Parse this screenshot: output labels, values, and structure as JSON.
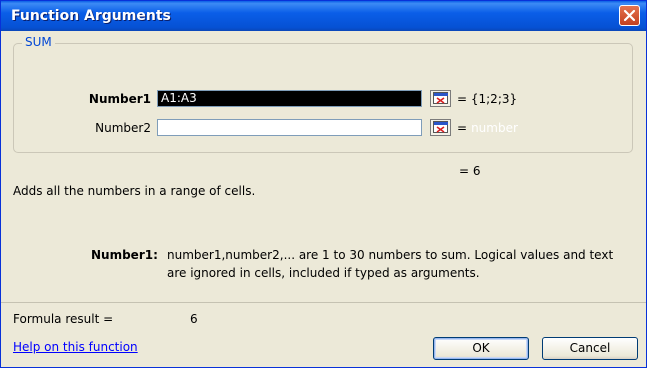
{
  "window": {
    "title": "Function Arguments"
  },
  "function_name": "SUM",
  "args": [
    {
      "label": "Number1",
      "value": "A1:A3",
      "result": "= {1;2;3}",
      "hint": ""
    },
    {
      "label": "Number2",
      "value": "",
      "result": "=",
      "hint": "number"
    }
  ],
  "function_result": "= 6",
  "description": "Adds all the numbers in a range of cells.",
  "arg_help": {
    "name": "Number1:",
    "line1": "number1,number2,... are 1 to 30 numbers to sum. Logical values and text",
    "line2": "are ignored in cells, included if typed as arguments."
  },
  "formula_result": {
    "label": "Formula result =",
    "value": "6"
  },
  "help_link": "Help on this function",
  "buttons": {
    "ok": "OK",
    "cancel": "Cancel"
  },
  "colors": {
    "titlebar": "#0a5ee8",
    "close": "#d9532d",
    "group_legend": "#0046d5",
    "link": "#0000ff"
  }
}
